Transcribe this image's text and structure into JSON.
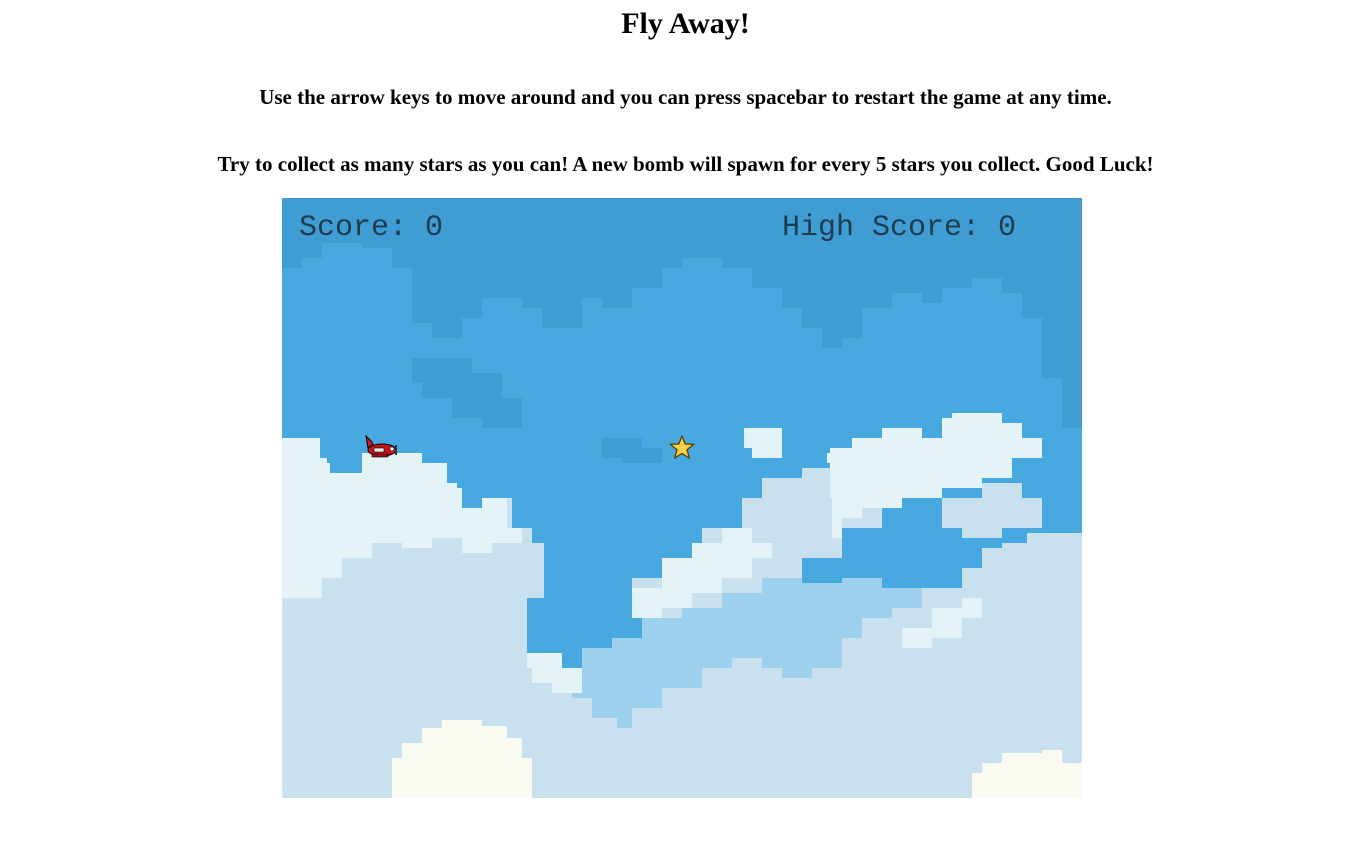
{
  "page": {
    "title": "Fly Away!",
    "instructions": [
      "Use the arrow keys to move around and you can press spacebar to restart the game at any time.",
      "Try to collect as many stars as you can! A new bomb will spawn for every 5 stars you collect. Good Luck!"
    ]
  },
  "game": {
    "score_label": "Score: ",
    "score": "0",
    "high_score_label": "High Score: ",
    "high_score": "0",
    "player_icon": "red-airplane-icon",
    "pickup_icon": "star-icon",
    "colors": {
      "sky": "#47a9e0",
      "sky_dark": "#3f9dd4",
      "cloud_far": "#9dd0ec",
      "cloud_mid": "#c9e1ee",
      "cloud_light": "#e3f3f6",
      "cloud_cream": "#f9faf1",
      "plane": "#c8141c",
      "star": "#fbd04a"
    }
  }
}
